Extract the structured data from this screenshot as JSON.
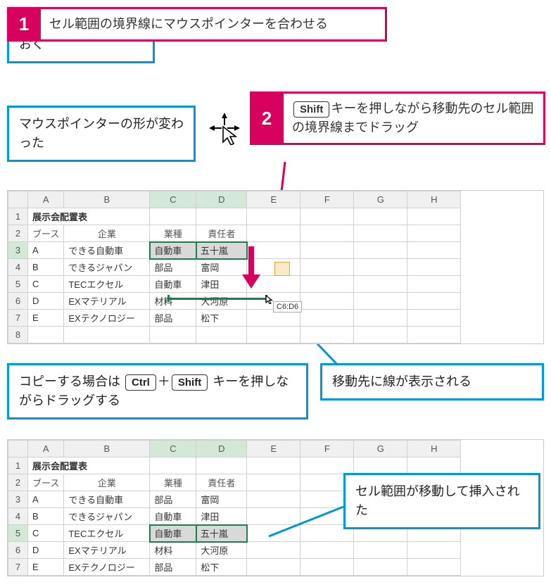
{
  "callouts": {
    "select_range": "セル範囲を選択しておく",
    "pointer_changed": "マウスポインターの形が変わった",
    "copy_hint_1": "コピーする場合は",
    "copy_hint_2": "キーを押しながらドラッグする",
    "dest_line": "移動先に線が表示される",
    "moved_inserted": "セル範囲が移動して挿入された"
  },
  "steps": {
    "s1": {
      "num": "1",
      "text": "セル範囲の境界線にマウスポインターを合わせる"
    },
    "s2": {
      "num": "2",
      "text_pre": "",
      "text_post": "キーを押しながら移動先のセル範囲の境界線までドラッグ"
    }
  },
  "keys": {
    "shift": "Shift",
    "ctrl": "Ctrl",
    "plus": "＋"
  },
  "sheet": {
    "cols": [
      "A",
      "B",
      "C",
      "D",
      "E",
      "F",
      "G",
      "H"
    ],
    "title": "展示会配置表",
    "headers": [
      "ブース",
      "企業",
      "業種",
      "責任者"
    ],
    "rows1": [
      [
        "A",
        "できる自動車",
        "自動車",
        "五十嵐"
      ],
      [
        "B",
        "できるジャパン",
        "部品",
        "富岡"
      ],
      [
        "C",
        "TECエクセル",
        "自動車",
        "津田"
      ],
      [
        "D",
        "EXマテリアル",
        "材料",
        "大河原"
      ],
      [
        "E",
        "EXテクノロジー",
        "部品",
        "松下"
      ]
    ],
    "rows2": [
      [
        "A",
        "できる自動車",
        "部品",
        "富岡"
      ],
      [
        "B",
        "できるジャパン",
        "自動車",
        "津田"
      ],
      [
        "C",
        "TECエクセル",
        "自動車",
        "五十嵐"
      ],
      [
        "D",
        "EXマテリアル",
        "材料",
        "大河原"
      ],
      [
        "E",
        "EXテクノロジー",
        "部品",
        "松下"
      ]
    ],
    "tooltip": "C6:D6"
  }
}
